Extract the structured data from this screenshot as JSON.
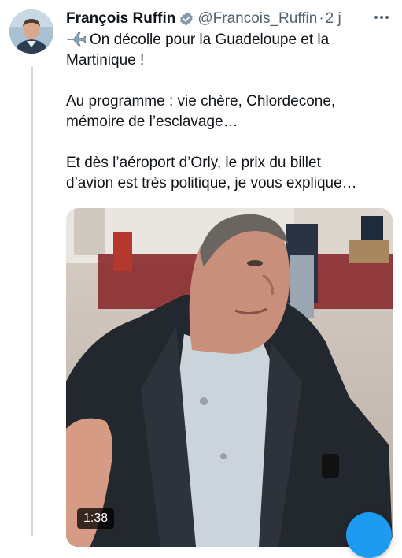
{
  "tweet": {
    "author_name": "François Ruffin",
    "handle": "@Francois_Ruffin",
    "separator": "·",
    "time": "2 j",
    "lines": [
      "On décolle pour la Guadeloupe et la",
      "Martinique !",
      "",
      "Au programme : vie chère, Chlordecone,",
      "mémoire de l’esclavage…",
      "",
      "Et dès l’aéroport d’Orly, le prix du billet",
      "d’avion est très politique, je vous explique…"
    ],
    "video_duration": "1:38"
  },
  "icons": {
    "verified": "verified-badge-icon",
    "more": "more-dots-icon",
    "plane": "airplane-emoji-icon",
    "fab": "compose-fab"
  },
  "colors": {
    "accent": "#1d9bf0",
    "secondary_text": "#536471",
    "verified_badge": "#829aab",
    "thread_line": "#cfd9de"
  }
}
